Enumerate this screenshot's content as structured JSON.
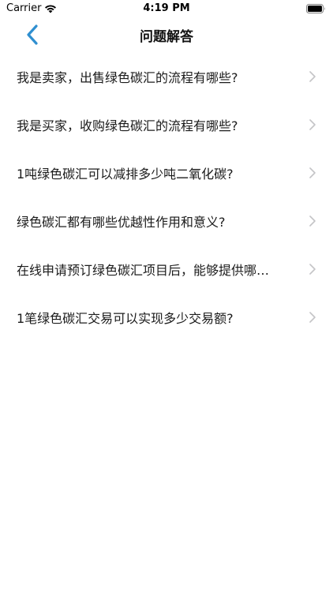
{
  "status_bar": {
    "carrier": "Carrier",
    "time": "4:19 PM"
  },
  "nav": {
    "title": "问题解答",
    "back_icon": "chevron-left-icon",
    "accent_color": "#2f8fd0"
  },
  "faq_items": [
    {
      "label": "我是卖家，出售绿色碳汇的流程有哪些?"
    },
    {
      "label": "我是买家，收购绿色碳汇的流程有哪些?"
    },
    {
      "label": "1吨绿色碳汇可以减排多少吨二氧化碳?"
    },
    {
      "label": "绿色碳汇都有哪些优越性作用和意义?"
    },
    {
      "label": "在线申请预订绿色碳汇项目后，能够提供哪…"
    },
    {
      "label": "1笔绿色碳汇交易可以实现多少交易额?"
    }
  ],
  "icons": {
    "row_chevron": "chevron-right-icon",
    "wifi": "wifi-icon",
    "battery": "battery-icon"
  }
}
